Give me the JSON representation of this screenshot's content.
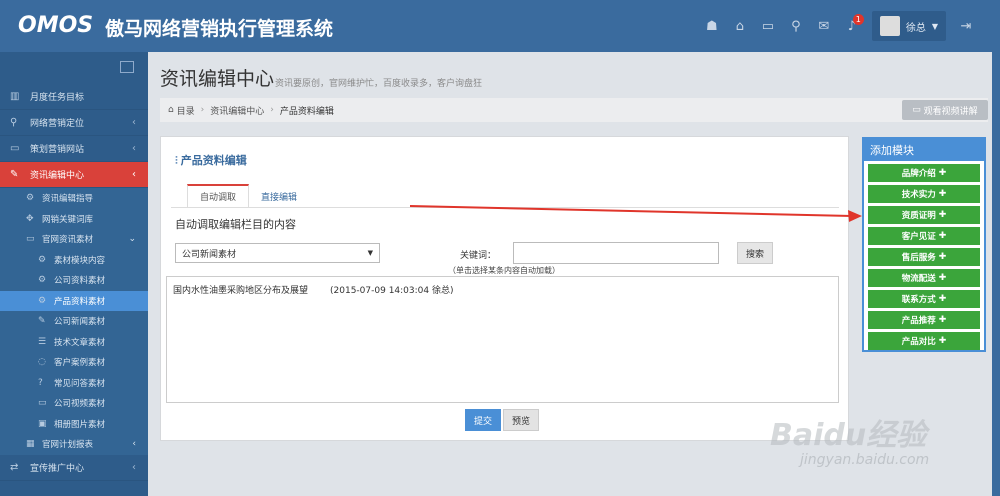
{
  "app": {
    "logo": "OMOS",
    "title": "傲马网络营销执行管理系统"
  },
  "topbar": {
    "icons": [
      "android-icon",
      "home-icon",
      "folder-icon",
      "location-icon",
      "mail-icon",
      "bell-icon"
    ],
    "badge_count": "1",
    "user_name": "徐总"
  },
  "sidebar": {
    "items": [
      {
        "label": "月度任务目标",
        "icon": "chart-icon"
      },
      {
        "label": "网络营销定位",
        "icon": "location-icon"
      },
      {
        "label": "策划营销网站",
        "icon": "monitor-icon"
      },
      {
        "label": "资讯编辑中心",
        "icon": "edit-icon"
      }
    ],
    "sub": [
      {
        "label": "资讯编辑指导"
      },
      {
        "label": "网销关键词库"
      },
      {
        "label": "官网资讯素材"
      }
    ],
    "sub3": [
      {
        "label": "素材模块内容"
      },
      {
        "label": "公司资料素材"
      },
      {
        "label": "产品资料素材"
      },
      {
        "label": "公司新闻素材"
      },
      {
        "label": "技术文章素材"
      },
      {
        "label": "客户案例素材"
      },
      {
        "label": "常见问答素材"
      },
      {
        "label": "公司视频素材"
      },
      {
        "label": "相册图片素材"
      }
    ],
    "after": [
      {
        "label": "官网计划报表"
      }
    ],
    "bottom": {
      "label": "宣传推广中心"
    }
  },
  "page": {
    "title": "资讯编辑中心",
    "subtitle": "资讯要原创，官网维护忙，百度收录多，客户询盘狂"
  },
  "breadcrumb": {
    "root": "目录",
    "level1": "资讯编辑中心",
    "current": "产品资料编辑"
  },
  "video_button": "观看视频讲解",
  "panel": {
    "title": "产品资料编辑",
    "tabs": [
      "自动调取",
      "直接编辑"
    ],
    "section_label": "自动调取编辑栏目的内容",
    "select_value": "公司新闻素材",
    "keyword_label": "关键词：",
    "keyword_value": "",
    "search_button": "搜索",
    "hint": "（单击选择某条内容自动加载）",
    "results": [
      {
        "title": "国内水性油墨采购地区分布及展望",
        "meta": "(2015-07-09 14:03:04  徐总)"
      }
    ],
    "submit_button": "提交",
    "preview_button": "预览"
  },
  "modules": {
    "title": "添加模块",
    "items": [
      "品牌介绍",
      "技术实力",
      "资质证明",
      "客户见证",
      "售后服务",
      "物流配送",
      "联系方式",
      "产品推荐",
      "产品对比"
    ]
  },
  "watermark": {
    "logo": "Baidu经验",
    "url": "jingyan.baidu.com"
  },
  "colors": {
    "header": "#3a6b9e",
    "sidebar": "#2e5c8a",
    "active_item": "#d9413a",
    "selected_sub": "#4a8fd6",
    "module_button": "#3ba53b",
    "arrow": "#e0352b"
  }
}
